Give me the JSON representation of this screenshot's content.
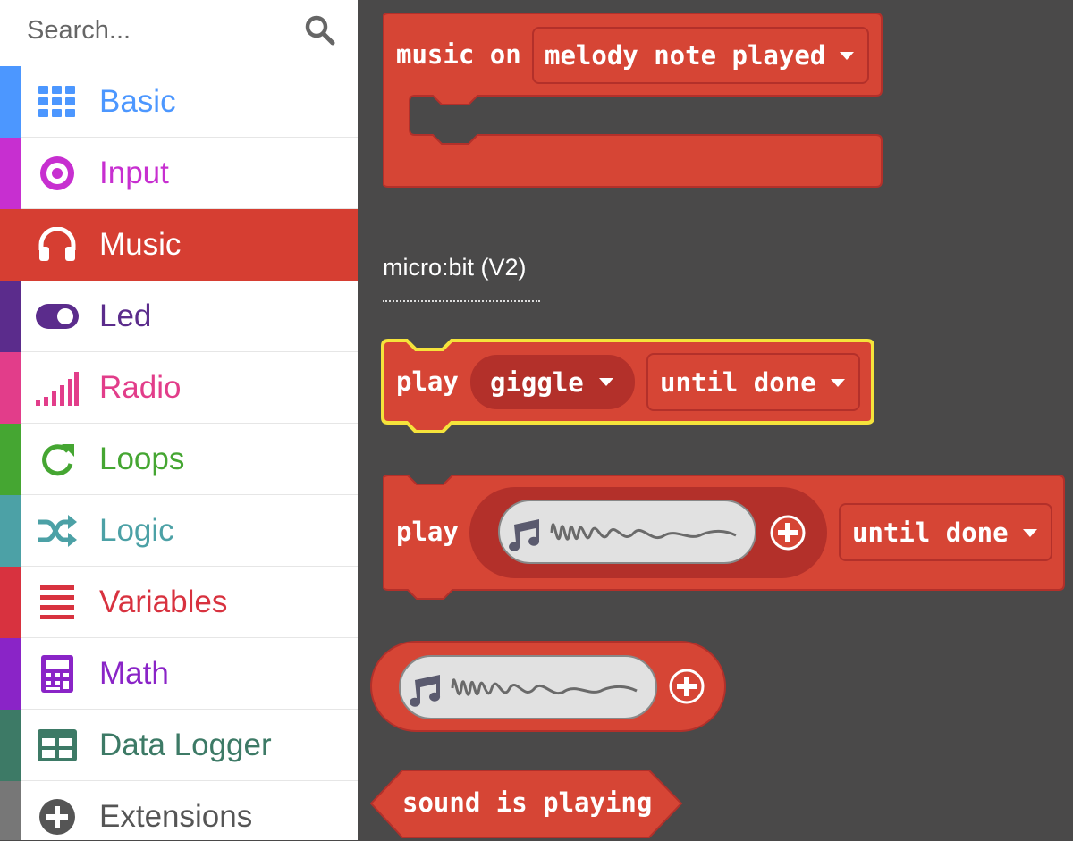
{
  "search": {
    "placeholder": "Search..."
  },
  "categories": [
    {
      "label": "Basic",
      "color": "#4c97ff",
      "icon": "grid-icon"
    },
    {
      "label": "Input",
      "color": "#c72fd0",
      "icon": "target-icon"
    },
    {
      "label": "Music",
      "color": "#d63e32",
      "icon": "headphones-icon",
      "selected": true
    },
    {
      "label": "Led",
      "color": "#5b2c8c",
      "icon": "toggle-icon"
    },
    {
      "label": "Radio",
      "color": "#e23d8a",
      "icon": "signal-bars-icon"
    },
    {
      "label": "Loops",
      "color": "#45a632",
      "icon": "refresh-icon"
    },
    {
      "label": "Logic",
      "color": "#4ca1a6",
      "icon": "shuffle-icon"
    },
    {
      "label": "Variables",
      "color": "#d8323f",
      "icon": "list-icon"
    },
    {
      "label": "Math",
      "color": "#8a24c7",
      "icon": "calculator-icon"
    },
    {
      "label": "Data Logger",
      "color": "#3d7a66",
      "icon": "table-icon"
    },
    {
      "label": "Extensions",
      "color": "#777777",
      "icon": "plus-circle-icon"
    }
  ],
  "workspace": {
    "block_color": "#d64535",
    "music_on_block": {
      "label": "music on",
      "dropdown": "melody note played"
    },
    "section_label": "micro:bit (V2)",
    "play_sound_block": {
      "label": "play",
      "sound": "giggle",
      "mode": "until done"
    },
    "play_expression_block": {
      "label": "play",
      "mode": "until done"
    },
    "sound_is_playing_block": {
      "label": "sound is playing"
    }
  }
}
